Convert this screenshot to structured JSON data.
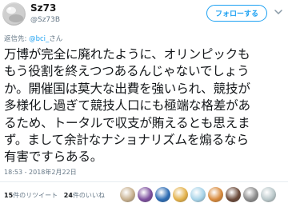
{
  "user": {
    "name": "Sz73",
    "handle": "@Sz73B"
  },
  "follow_label": "フォローする",
  "reply_to": {
    "prefix": "返信先: ",
    "mention": "@bci_",
    "suffix": "さん"
  },
  "tweet_lines": [
    "万博が完全に廃れたように、オリンピックも",
    "もう役割を終えつつあるんじゃないでしょう",
    "か。開催国は莫大な出費を強いられ、競技が",
    "多様化し過ぎて競技人口にも極端な格差があ",
    "るため、トータルで収支が賄えるとも思えま",
    "ず。まして余計なナショナリズムを煽るなら",
    "有害ですらある。"
  ],
  "timestamp": "18:53 - 2018年2月22日",
  "stats": {
    "retweets_count": "15",
    "retweets_label": "件のリツイート",
    "likes_count": "24",
    "likes_label": "件のいいね"
  },
  "liker_avatars": [
    {
      "icon": "avatar-1",
      "color": "#c7b08e"
    },
    {
      "icon": "avatar-2",
      "color": "#7d4f9e"
    },
    {
      "icon": "avatar-3",
      "color": "#2e6db5"
    },
    {
      "icon": "avatar-4",
      "color": "#e3b14a"
    },
    {
      "icon": "avatar-5",
      "color": "#a7d3e8"
    },
    {
      "icon": "avatar-6",
      "color": "#d88a3c"
    },
    {
      "icon": "avatar-7",
      "color": "#6b4a3a"
    },
    {
      "icon": "avatar-8",
      "color": "#8c8c8c"
    },
    {
      "icon": "avatar-9",
      "color": "#b9c7c9"
    }
  ],
  "colors": {
    "accent": "#1da1f2",
    "secondary_text": "#657786"
  }
}
